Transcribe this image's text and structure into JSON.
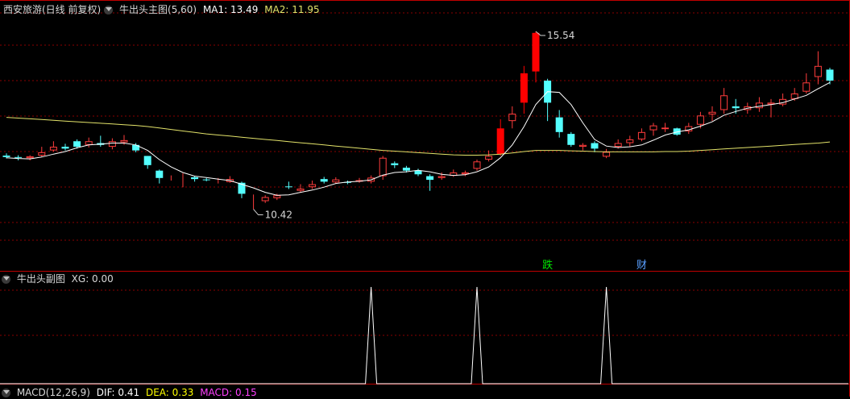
{
  "header_main": {
    "stock_name": "西安旅游(日线 前复权)",
    "indicator": "牛出头主图(5,60)",
    "ma1_label": "MA1: 13.49",
    "ma2_label": "MA2: 11.95"
  },
  "header_sub": {
    "indicator": "牛出头副图",
    "xg_label": "XG: 0.00"
  },
  "header_macd": {
    "name": "MACD(12,26,9)",
    "dif_label": "DIF: 0.41",
    "dea_label": "DEA: 0.33",
    "macd_label": "MACD: 0.15"
  },
  "colors": {
    "up": "#ff3c3c",
    "down": "#54ffff",
    "big_up": "#ff0000",
    "big_down": "#00e600",
    "ma1": "#ffffff",
    "ma2": "#e3e36a",
    "grid": "#8a0000",
    "divider": "#c00000",
    "xg_line": "#ffffff",
    "dif": "#ffffff",
    "dea": "#ffff00",
    "macd": "#ff40ff"
  },
  "chart_data": [
    {
      "type": "candlestick",
      "ylim": [
        9.9,
        16.0
      ],
      "annotations": {
        "high": "15.54",
        "low": "10.42"
      },
      "markers": [
        {
          "index": 46,
          "text": "跌",
          "color": "#00e600"
        },
        {
          "index": 54,
          "text": "财",
          "color": "#5aa0ff"
        }
      ],
      "candles": [
        [
          12.16,
          12.12,
          12.22,
          12.08
        ],
        [
          12.12,
          12.1,
          12.17,
          12.03
        ],
        [
          12.09,
          12.14,
          12.17,
          12.03
        ],
        [
          12.16,
          12.25,
          12.4,
          12.13
        ],
        [
          12.3,
          12.4,
          12.55,
          12.27
        ],
        [
          12.4,
          12.35,
          12.48,
          12.3
        ],
        [
          12.55,
          12.4,
          12.6,
          12.35
        ],
        [
          12.45,
          12.55,
          12.65,
          12.38
        ],
        [
          12.5,
          12.45,
          12.7,
          12.4
        ],
        [
          12.4,
          12.55,
          12.63,
          12.33
        ],
        [
          12.52,
          12.58,
          12.72,
          12.45
        ],
        [
          12.45,
          12.3,
          12.5,
          12.25
        ],
        [
          12.15,
          11.9,
          12.15,
          11.8
        ],
        [
          11.75,
          11.55,
          11.78,
          11.4
        ],
        [
          11.54,
          11.56,
          11.62,
          11.48
        ],
        [
          11.57,
          11.58,
          11.68,
          11.3
        ],
        [
          11.57,
          11.52,
          11.6,
          11.45
        ],
        [
          11.51,
          11.5,
          11.55,
          11.46
        ],
        [
          11.45,
          11.45,
          11.55,
          11.4
        ],
        [
          11.44,
          11.52,
          11.6,
          11.42
        ],
        [
          11.42,
          11.12,
          11.45,
          11.0
        ],
        [
          11.0,
          11.0,
          11.1,
          10.7
        ],
        [
          10.92,
          11.03,
          11.08,
          10.87
        ],
        [
          11.0,
          11.08,
          11.12,
          10.95
        ],
        [
          11.32,
          11.3,
          11.45,
          11.25
        ],
        [
          11.2,
          11.26,
          11.38,
          11.15
        ],
        [
          11.3,
          11.38,
          11.48,
          11.25
        ],
        [
          11.52,
          11.45,
          11.58,
          11.4
        ],
        [
          11.43,
          11.51,
          11.57,
          11.4
        ],
        [
          11.44,
          11.42,
          11.48,
          11.38
        ],
        [
          11.45,
          11.49,
          11.55,
          11.42
        ],
        [
          11.45,
          11.56,
          11.62,
          11.4
        ],
        [
          11.6,
          12.1,
          12.15,
          11.5
        ],
        [
          11.95,
          11.9,
          12.0,
          11.82
        ],
        [
          11.83,
          11.75,
          11.88,
          11.7
        ],
        [
          11.75,
          11.65,
          11.8,
          11.6
        ],
        [
          11.6,
          11.5,
          11.65,
          11.2
        ],
        [
          11.55,
          11.6,
          11.7,
          11.5
        ],
        [
          11.61,
          11.7,
          11.78,
          11.58
        ],
        [
          11.65,
          11.7,
          11.75,
          11.6
        ],
        [
          11.8,
          12.0,
          12.05,
          11.75
        ],
        [
          12.05,
          12.15,
          12.3,
          12.0
        ],
        [
          12.2,
          12.9,
          13.15,
          12.15
        ],
        [
          13.1,
          13.3,
          13.5,
          12.9
        ],
        [
          13.6,
          14.4,
          14.6,
          13.3
        ],
        [
          14.45,
          15.5,
          15.54,
          14.15
        ],
        [
          14.2,
          13.6,
          14.25,
          13.1
        ],
        [
          13.2,
          12.8,
          13.4,
          12.65
        ],
        [
          12.75,
          12.45,
          12.8,
          12.4
        ],
        [
          12.4,
          12.45,
          12.5,
          12.3
        ],
        [
          12.5,
          12.35,
          12.55,
          12.25
        ],
        [
          12.13,
          12.26,
          12.34,
          12.09
        ],
        [
          12.4,
          12.5,
          12.6,
          12.35
        ],
        [
          12.5,
          12.6,
          12.7,
          12.4
        ],
        [
          12.6,
          12.8,
          12.9,
          12.55
        ],
        [
          12.85,
          12.98,
          13.05,
          12.7
        ],
        [
          12.88,
          12.92,
          13.05,
          12.8
        ],
        [
          12.9,
          12.73,
          12.92,
          12.7
        ],
        [
          12.82,
          12.96,
          13.05,
          12.75
        ],
        [
          13.0,
          13.25,
          13.35,
          12.9
        ],
        [
          13.28,
          13.35,
          13.5,
          13.1
        ],
        [
          13.4,
          13.8,
          14.0,
          13.3
        ],
        [
          13.5,
          13.45,
          13.7,
          13.3
        ],
        [
          13.4,
          13.5,
          13.6,
          13.3
        ],
        [
          13.45,
          13.6,
          13.75,
          13.35
        ],
        [
          13.55,
          13.6,
          13.7,
          13.2
        ],
        [
          13.55,
          13.7,
          13.85,
          13.5
        ],
        [
          13.7,
          13.85,
          14.0,
          13.65
        ],
        [
          13.9,
          14.15,
          14.4,
          13.85
        ],
        [
          14.3,
          14.6,
          15.0,
          14.1
        ],
        [
          14.5,
          14.2,
          14.55,
          14.1
        ]
      ],
      "ma1": [
        12.1,
        12.08,
        12.07,
        12.12,
        12.2,
        12.27,
        12.37,
        12.45,
        12.47,
        12.5,
        12.5,
        12.45,
        12.3,
        12.05,
        11.85,
        11.7,
        11.6,
        11.56,
        11.52,
        11.48,
        11.38,
        11.28,
        11.16,
        11.08,
        11.09,
        11.16,
        11.22,
        11.3,
        11.4,
        11.44,
        11.46,
        11.5,
        11.63,
        11.7,
        11.72,
        11.76,
        11.72,
        11.65,
        11.62,
        11.64,
        11.72,
        11.85,
        12.1,
        12.45,
        12.95,
        13.55,
        13.9,
        13.88,
        13.55,
        13.05,
        12.6,
        12.42,
        12.38,
        12.4,
        12.45,
        12.58,
        12.72,
        12.8,
        12.86,
        12.96,
        13.08,
        13.26,
        13.36,
        13.45,
        13.5,
        13.55,
        13.6,
        13.7,
        13.8,
        13.98,
        14.15
      ],
      "ma2": [
        13.2,
        13.18,
        13.16,
        13.14,
        13.12,
        13.1,
        13.08,
        13.06,
        13.04,
        13.02,
        13.0,
        12.98,
        12.95,
        12.91,
        12.87,
        12.83,
        12.79,
        12.75,
        12.72,
        12.69,
        12.66,
        12.63,
        12.6,
        12.57,
        12.54,
        12.51,
        12.48,
        12.45,
        12.42,
        12.39,
        12.36,
        12.33,
        12.3,
        12.28,
        12.26,
        12.24,
        12.22,
        12.2,
        12.18,
        12.17,
        12.17,
        12.18,
        12.2,
        12.23,
        12.27,
        12.3,
        12.3,
        12.3,
        12.29,
        12.28,
        12.27,
        12.26,
        12.26,
        12.26,
        12.26,
        12.26,
        12.27,
        12.27,
        12.28,
        12.3,
        12.32,
        12.34,
        12.36,
        12.38,
        12.4,
        12.42,
        12.44,
        12.46,
        12.48,
        12.5,
        12.53
      ]
    },
    {
      "type": "line",
      "name": "XG",
      "ylim": [
        0,
        1
      ],
      "pulses": [
        31,
        40,
        51
      ]
    }
  ]
}
